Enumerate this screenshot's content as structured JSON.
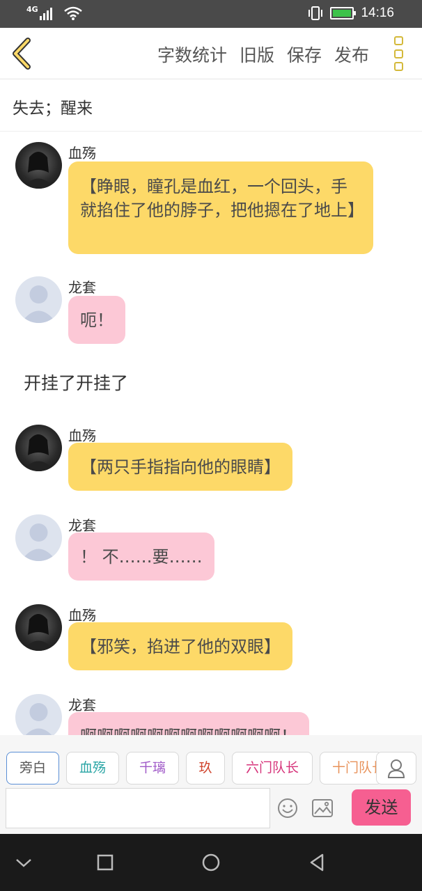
{
  "status_bar": {
    "network": "4G",
    "time": "14:16",
    "icons": [
      "signal-icon",
      "wifi-icon",
      "vibrate-icon",
      "battery-charging-icon"
    ]
  },
  "header": {
    "back_icon": "chevron-left-icon",
    "actions": [
      "字数统计",
      "旧版",
      "保存",
      "发布"
    ],
    "more_icon": "more-vertical-icon",
    "accent_color": "#d4b93a"
  },
  "title": "失去；醒来",
  "messages": [
    {
      "kind": "bubble",
      "sender": "血殇",
      "avatar": "dark",
      "color": "yellow",
      "text": "【睁眼，瞳孔是血红，一个回头，手就掐住了他的脖子，把他摁在了地上】"
    },
    {
      "kind": "bubble",
      "sender": "龙套",
      "avatar": "default",
      "color": "pink",
      "text": "呃！"
    },
    {
      "kind": "narration",
      "text": "开挂了开挂了"
    },
    {
      "kind": "bubble",
      "sender": "血殇",
      "avatar": "dark",
      "color": "yellow",
      "text": "【两只手指指向他的眼睛】"
    },
    {
      "kind": "bubble",
      "sender": "龙套",
      "avatar": "default",
      "color": "pink",
      "text": "！ 不……要……"
    },
    {
      "kind": "bubble",
      "sender": "血殇",
      "avatar": "dark",
      "color": "yellow",
      "text": "【邪笑，掐进了他的双眼】"
    },
    {
      "kind": "bubble",
      "sender": "龙套",
      "avatar": "default",
      "color": "pink",
      "text": "啊啊啊啊啊啊啊啊啊啊啊啊！"
    }
  ],
  "roles": [
    {
      "label": "旁白",
      "color": "#555555",
      "active": true
    },
    {
      "label": "血殇",
      "color": "#2aa5a5"
    },
    {
      "label": "千璃",
      "color": "#a05ac8"
    },
    {
      "label": "玖",
      "color": "#d0452e"
    },
    {
      "label": "六门队长",
      "color": "#d6337a"
    },
    {
      "label": "十门队长",
      "color": "#e8925a"
    }
  ],
  "input": {
    "placeholder": "",
    "send_label": "发送",
    "emoji_icon": "smile-icon",
    "image_icon": "image-icon",
    "send_color": "#f65f91"
  },
  "nav": [
    "chevron-down-icon",
    "square-icon",
    "circle-icon",
    "triangle-back-icon"
  ]
}
